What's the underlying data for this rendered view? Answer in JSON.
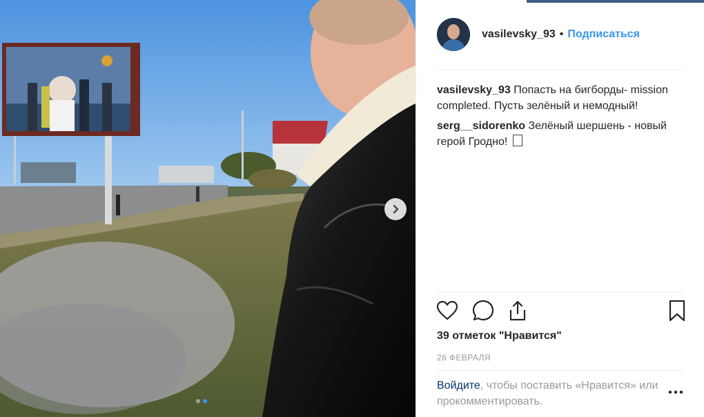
{
  "post": {
    "author": "vasilevsky_93",
    "separator": "•",
    "follow_label": "Подписаться",
    "caption": {
      "user": "vasilevsky_93",
      "text": "Попасть на бигборды- mission completed. Пусть зелёный и немодный!"
    },
    "comments": [
      {
        "user": "serg__sidorenko",
        "text": "Зелёный шершень - новый герой Гродно!"
      }
    ],
    "likes_text": "39 отметок \"Нравится\"",
    "date_text": "26 ФЕВРАЛЯ",
    "login_prompt": {
      "link": "Войдите",
      "text": ", чтобы поставить «Нравится» или прокомментировать."
    }
  },
  "carousel": {
    "slides": 2,
    "active_index": 1
  },
  "icons": {
    "like": "heart-icon",
    "comment": "comment-icon",
    "share": "share-icon",
    "save": "bookmark-icon",
    "next": "chevron-right-icon",
    "more": "more-options-icon"
  },
  "colors": {
    "link_blue": "#3897f0",
    "login_link": "#003569",
    "text": "#262626",
    "muted": "#999999",
    "divider": "#efefef"
  }
}
